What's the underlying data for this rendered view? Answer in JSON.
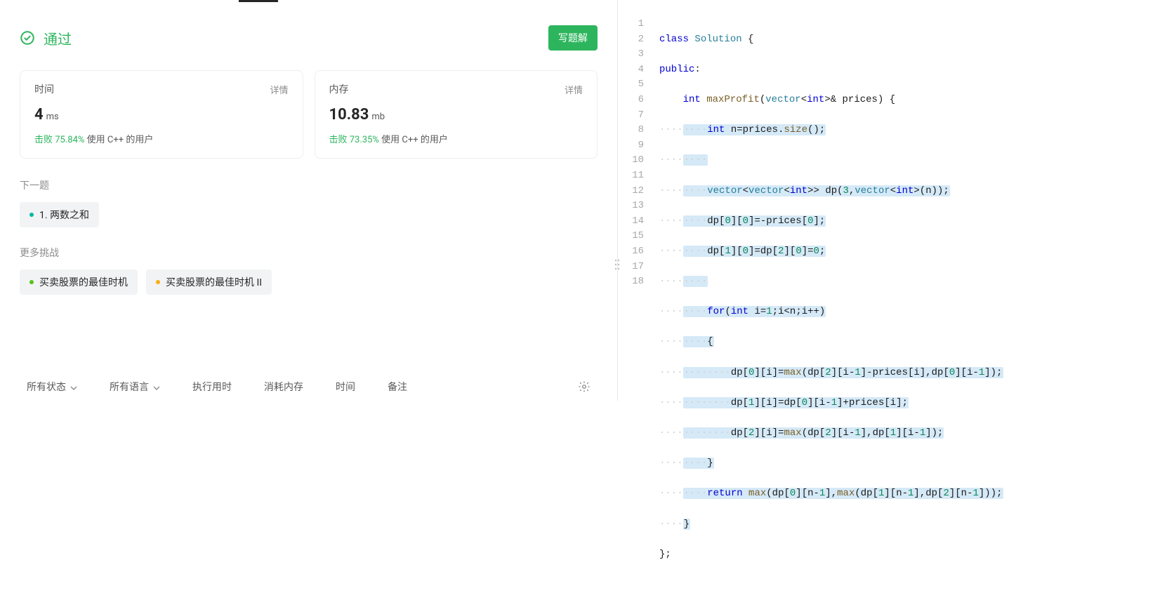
{
  "status": {
    "text": "通过",
    "write_solution_label": "写题解"
  },
  "cards": {
    "time": {
      "label": "时间",
      "detail": "详情",
      "value": "4",
      "unit": "ms",
      "beat_prefix": "击败",
      "beat_pct": "75.84%",
      "beat_suffix": "使用 C++ 的用户"
    },
    "memory": {
      "label": "内存",
      "detail": "详情",
      "value": "10.83",
      "unit": "mb",
      "beat_prefix": "击败",
      "beat_pct": "73.35%",
      "beat_suffix": "使用 C++ 的用户"
    }
  },
  "next_label": "下一题",
  "next_item": "1. 两数之和",
  "more_label": "更多挑战",
  "more_items": {
    "a": "买卖股票的最佳时机",
    "b": "买卖股票的最佳时机 II"
  },
  "filters": {
    "all_status": "所有状态",
    "all_lang": "所有语言",
    "exec_time": "执行用时",
    "mem": "消耗内存",
    "time": "时间",
    "note": "备注"
  },
  "code_lines": [
    {
      "n": "1"
    },
    {
      "n": "2"
    },
    {
      "n": "3"
    },
    {
      "n": "4"
    },
    {
      "n": "5"
    },
    {
      "n": "6"
    },
    {
      "n": "7"
    },
    {
      "n": "8"
    },
    {
      "n": "9"
    },
    {
      "n": "10"
    },
    {
      "n": "11"
    },
    {
      "n": "12"
    },
    {
      "n": "13"
    },
    {
      "n": "14"
    },
    {
      "n": "15"
    },
    {
      "n": "16"
    },
    {
      "n": "17"
    },
    {
      "n": "18"
    }
  ],
  "code": {
    "class_kw": "class",
    "class_name": "Solution",
    "public_kw": "public",
    "int_kw": "int",
    "fn_maxProfit": "maxProfit",
    "vector": "vector",
    "prices": "prices",
    "fn_size": "size",
    "dp": "dp",
    "for_kw": "for",
    "return_kw": "return",
    "fn_max": "max",
    "n_var": "n",
    "i_var": "i",
    "num0": "0",
    "num1": "1",
    "num2": "2",
    "num3": "3"
  }
}
